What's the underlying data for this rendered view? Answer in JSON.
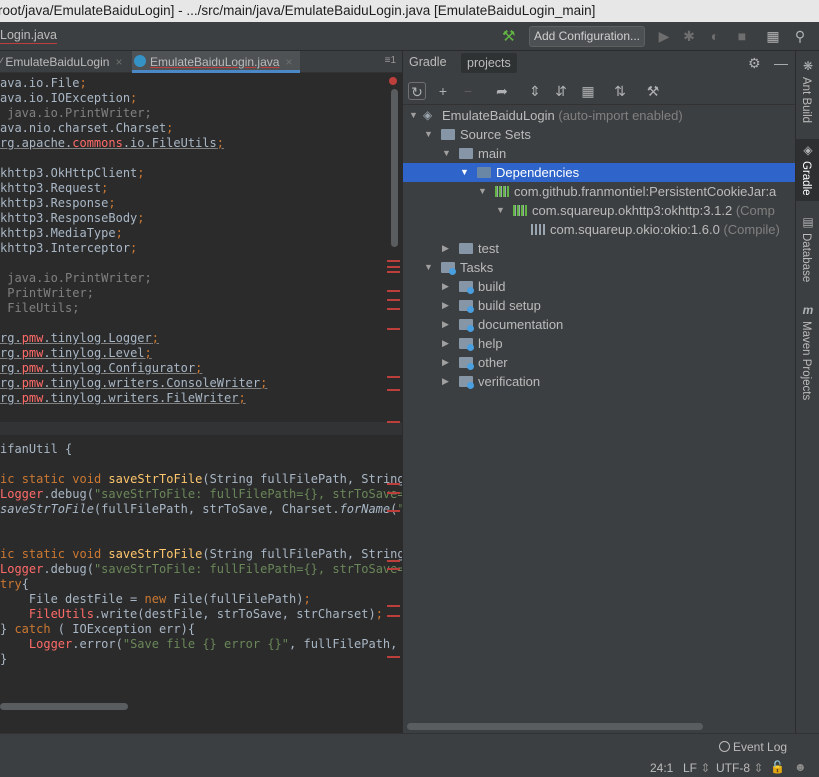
{
  "window": {
    "title": "root/java/EmulateBaiduLogin] - .../src/main/java/EmulateBaiduLogin.java [EmulateBaiduLogin_main]"
  },
  "navbar": {
    "file_label": "Login.java",
    "add_configuration": "Add Configuration..."
  },
  "editor_tabs": [
    {
      "label": "EmulateBaiduLogin"
    },
    {
      "label": "EmulateBaiduLogin.java"
    }
  ],
  "editor_tab_menu": "1",
  "gradle": {
    "tabs": [
      "Gradle",
      "projects"
    ],
    "tree": [
      {
        "label": "EmulateBaiduLogin",
        "sub": "(auto-import enabled)"
      },
      {
        "label": "Source Sets"
      },
      {
        "label": "main"
      },
      {
        "label": "Dependencies"
      },
      {
        "label": "com.github.franmontiel:PersistentCookieJar:a"
      },
      {
        "label": "com.squareup.okhttp3:okhttp:3.1.2",
        "sub": "(Comp"
      },
      {
        "label": "com.squareup.okio:okio:1.6.0",
        "sub": "(Compile)"
      },
      {
        "label": "test"
      },
      {
        "label": "Tasks"
      },
      {
        "label": "build"
      },
      {
        "label": "build setup"
      },
      {
        "label": "documentation"
      },
      {
        "label": "help"
      },
      {
        "label": "other"
      },
      {
        "label": "verification"
      }
    ]
  },
  "right_sidebar": {
    "items": [
      "Ant Build",
      "Gradle",
      "Database",
      "Maven Projects"
    ]
  },
  "status": {
    "event_log": "Event Log",
    "position": "24:1",
    "line_sep": "LF",
    "encoding": "UTF-8"
  },
  "code_lines": [
    "ava.io.File;",
    "ava.io.IOException;",
    " java.io.PrintWriter;",
    "ava.nio.charset.Charset;",
    "rg.apache.commons.io.FileUtils;",
    "",
    "khttp3.OkHttpClient;",
    "khttp3.Request;",
    "khttp3.Response;",
    "khttp3.ResponseBody;",
    "khttp3.MediaType;",
    "khttp3.Interceptor;",
    "",
    " java.io.PrintWriter;",
    " PrintWriter;",
    " FileUtils;",
    "",
    "rg.pmw.tinylog.Logger;",
    "rg.pmw.tinylog.Level;",
    "rg.pmw.tinylog.Configurator;",
    "rg.pmw.tinylog.writers.ConsoleWriter;",
    "rg.pmw.tinylog.writers.FileWriter;",
    "",
    "",
    "ifanUtil {",
    "",
    "ic static void saveStrToFile(String fullFilePath, String s",
    "Logger.debug(\"saveStrToFile: fullFilePath={}, strToSave={}",
    "saveStrToFile(fullFilePath, strToSave, Charset.forName(\"UT",
    "",
    "",
    "ic static void saveStrToFile(String fullFilePath, String s",
    "Logger.debug(\"saveStrToFile: fullFilePath={}, strToSave={}",
    "try{",
    "    File destFile = new File(fullFilePath);",
    "    FileUtils.write(destFile, strToSave, strCharset);",
    "} catch ( IOException err){",
    "    Logger.error(\"Save file {} error {}\", fullFilePath, er",
    "}"
  ]
}
